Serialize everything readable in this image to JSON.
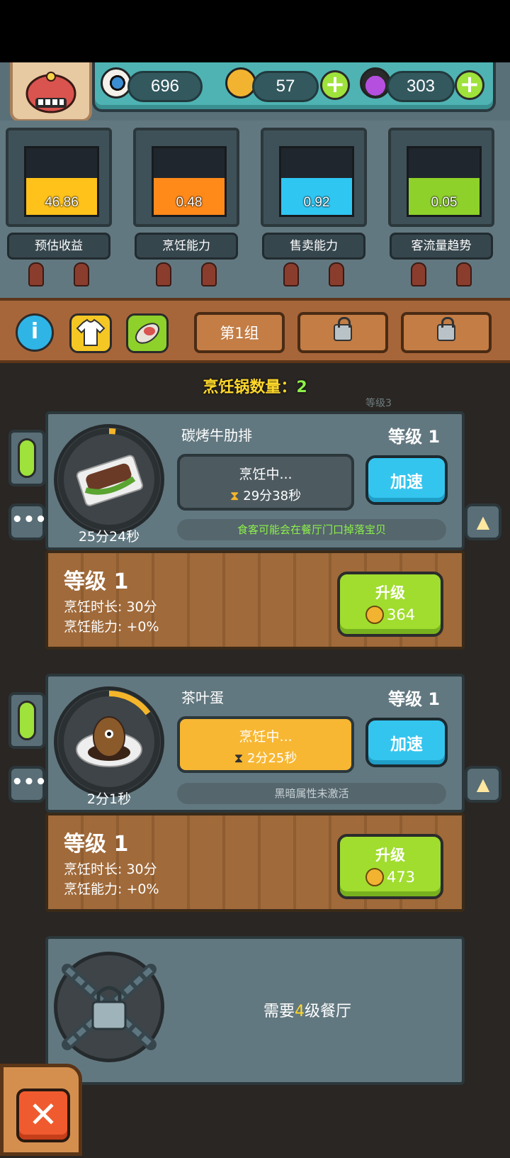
{
  "resources": {
    "eyeball": {
      "value": "696",
      "icon": "eyeball-icon"
    },
    "coins": {
      "value": "57",
      "icon": "coin-icon"
    },
    "potion": {
      "value": "303",
      "icon": "potion-icon"
    }
  },
  "gauges": [
    {
      "value": "46.86",
      "label": "预估收益",
      "color": "#ffc21a",
      "level": 0.55
    },
    {
      "value": "0.48",
      "label": "烹饪能力",
      "color": "#ff8a1a",
      "level": 0.55
    },
    {
      "value": "0.92",
      "label": "售卖能力",
      "color": "#2fc6f2",
      "level": 0.55
    },
    {
      "value": "0.05",
      "label": "客流量趋势",
      "color": "#8ed12a",
      "level": 0.55
    }
  ],
  "tabs": {
    "group1": "第1组"
  },
  "pot_count": {
    "label": "烹饪锅数量：",
    "value": "2"
  },
  "background_label": "等级3",
  "slots": [
    {
      "timer": "25分24秒",
      "dish": "碳烤牛肋排",
      "level": "等级 1",
      "status": "烹饪中...",
      "remaining": "29分38秒",
      "speed": "加速",
      "hint": "食客可能会在餐厅门口掉落宝贝",
      "info_level": "等级 1",
      "info_time": "烹饪时长: 30分",
      "info_power": "烹饪能力: +0%",
      "upgrade": "升级",
      "upgrade_cost": "364",
      "progress": 0.02
    },
    {
      "timer": "2分1秒",
      "dish": "茶叶蛋",
      "level": "等级 1",
      "status": "烹饪中...",
      "remaining": "2分25秒",
      "speed": "加速",
      "hint": "黑暗属性未激活",
      "info_level": "等级 1",
      "info_time": "烹饪时长: 30分",
      "info_power": "烹饪能力: +0%",
      "upgrade": "升级",
      "upgrade_cost": "473",
      "progress": 0.2
    }
  ],
  "locked_slot": {
    "prefix": "需要",
    "num": "4",
    "suffix": "级餐厅"
  }
}
